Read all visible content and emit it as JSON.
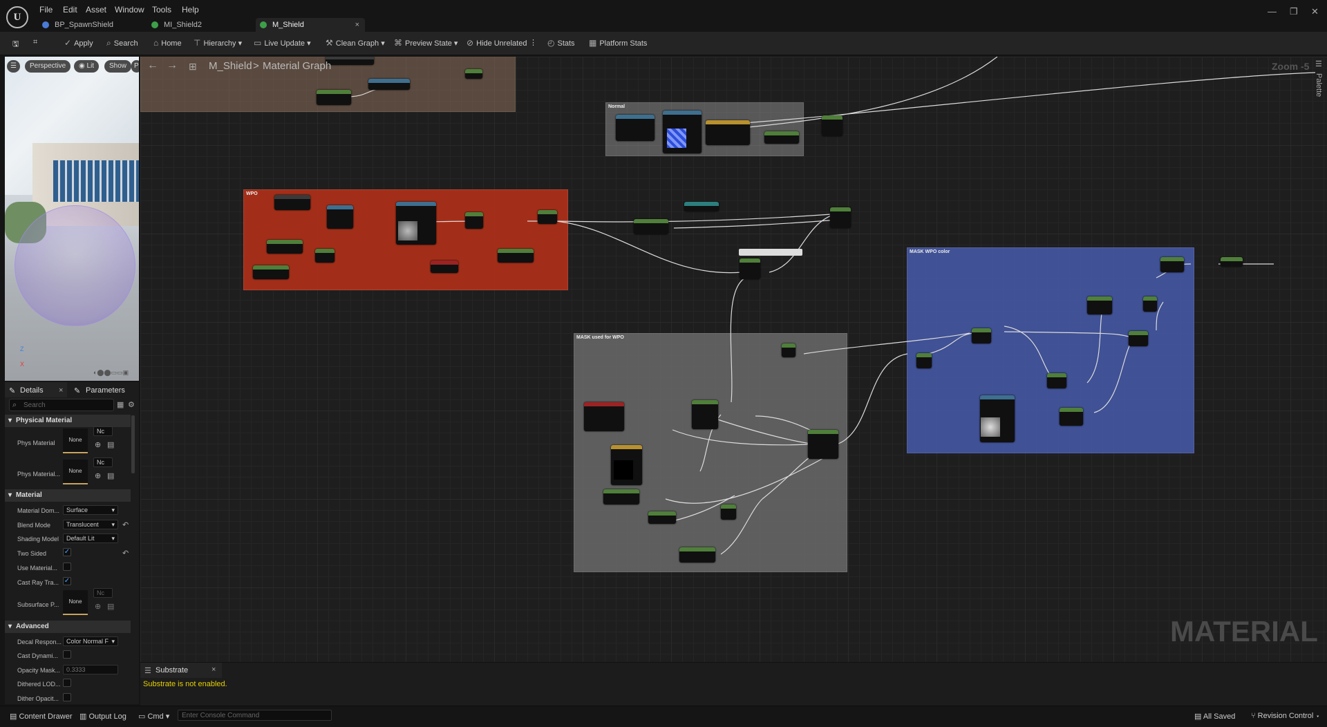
{
  "logo_text": "U",
  "menu": [
    "File",
    "Edit",
    "Asset",
    "Window",
    "Tools",
    "Help"
  ],
  "tabs": [
    {
      "label": "BP_SpawnShield",
      "color": "#4a7bd6"
    },
    {
      "label": "MI_Shield2",
      "color": "#3d9f4a"
    },
    {
      "label": "M_Shield",
      "color": "#3d9f4a",
      "active": true
    }
  ],
  "tab_close": "×",
  "window_controls": [
    "—",
    "❐",
    "✕"
  ],
  "toolbar": {
    "apply": "Apply",
    "search": "Search",
    "home": "Home",
    "hierarchy": "Hierarchy",
    "live_update": "Live Update",
    "clean_graph": "Clean Graph",
    "preview_state": "Preview State",
    "hide_unrelated": "Hide Unrelated",
    "stats": "Stats",
    "platform_stats": "Platform Stats"
  },
  "viewport": {
    "perspective": "Perspective",
    "lit": "Lit",
    "show": "Show",
    "extra": "P"
  },
  "left_panel": {
    "details_tab": "Details",
    "parameters_tab": "Parameters",
    "search_placeholder": "Search",
    "physical_material": {
      "title": "Physical Material",
      "rows": [
        {
          "label": "Phys Material",
          "thumb": "None",
          "dropdown": "Nc"
        },
        {
          "label": "Phys Material...",
          "thumb": "None",
          "dropdown": "Nc"
        }
      ]
    },
    "material": {
      "title": "Material",
      "material_domain": {
        "label": "Material Dom...",
        "value": "Surface"
      },
      "blend_mode": {
        "label": "Blend Mode",
        "value": "Translucent"
      },
      "shading_model": {
        "label": "Shading Model",
        "value": "Default Lit"
      },
      "two_sided": {
        "label": "Two Sided",
        "checked": true
      },
      "use_material": {
        "label": "Use Material...",
        "checked": false
      },
      "cast_ray": {
        "label": "Cast Ray Tra...",
        "checked": true
      },
      "subsurface": {
        "label": "Subsurface P...",
        "thumb": "None",
        "dropdown": "Nc"
      }
    },
    "advanced": {
      "title": "Advanced",
      "decal_response": {
        "label": "Decal Respon...",
        "value": "Color Normal F"
      },
      "cast_dynamic": {
        "label": "Cast Dynami...",
        "checked": false
      },
      "opacity_mask": {
        "label": "Opacity Mask...",
        "value": "0.3333"
      },
      "dithered_lod": {
        "label": "Dithered LOD...",
        "checked": false
      },
      "dither_opacity": {
        "label": "Dither Opacit...",
        "checked": false
      }
    }
  },
  "graph": {
    "breadcrumb_root": "M_Shield",
    "breadcrumb_sep": ">",
    "breadcrumb_child": "Material Graph",
    "zoom": "Zoom -5",
    "palette": "Palette",
    "watermark": "MATERIAL",
    "comments": {
      "wpo": "WPO",
      "mask_wpo": "MASK used for WPO",
      "mask_color": "MASK WPO color",
      "normal": "Normal"
    }
  },
  "bottom_panel": {
    "tab": "Substrate",
    "message": "Substrate is not enabled."
  },
  "status_bar": {
    "content_drawer": "Content Drawer",
    "output_log": "Output Log",
    "cmd": "Cmd",
    "console_placeholder": "Enter Console Command",
    "all_saved": "All Saved",
    "revision_control": "Revision Control"
  }
}
